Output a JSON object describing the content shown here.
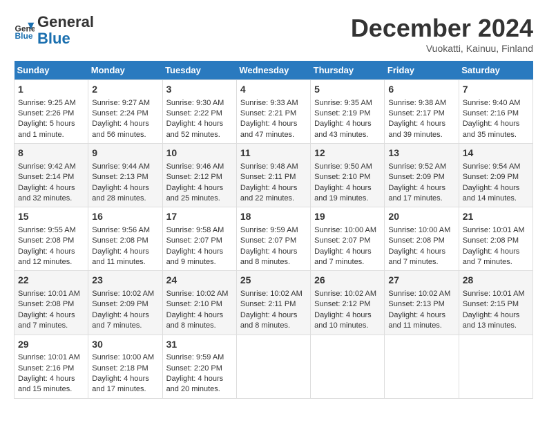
{
  "header": {
    "logo_line1": "General",
    "logo_line2": "Blue",
    "month": "December 2024",
    "location": "Vuokatti, Kainuu, Finland"
  },
  "weekdays": [
    "Sunday",
    "Monday",
    "Tuesday",
    "Wednesday",
    "Thursday",
    "Friday",
    "Saturday"
  ],
  "weeks": [
    [
      {
        "day": "1",
        "sunrise": "Sunrise: 9:25 AM",
        "sunset": "Sunset: 2:26 PM",
        "daylight": "Daylight: 5 hours and 1 minute."
      },
      {
        "day": "2",
        "sunrise": "Sunrise: 9:27 AM",
        "sunset": "Sunset: 2:24 PM",
        "daylight": "Daylight: 4 hours and 56 minutes."
      },
      {
        "day": "3",
        "sunrise": "Sunrise: 9:30 AM",
        "sunset": "Sunset: 2:22 PM",
        "daylight": "Daylight: 4 hours and 52 minutes."
      },
      {
        "day": "4",
        "sunrise": "Sunrise: 9:33 AM",
        "sunset": "Sunset: 2:21 PM",
        "daylight": "Daylight: 4 hours and 47 minutes."
      },
      {
        "day": "5",
        "sunrise": "Sunrise: 9:35 AM",
        "sunset": "Sunset: 2:19 PM",
        "daylight": "Daylight: 4 hours and 43 minutes."
      },
      {
        "day": "6",
        "sunrise": "Sunrise: 9:38 AM",
        "sunset": "Sunset: 2:17 PM",
        "daylight": "Daylight: 4 hours and 39 minutes."
      },
      {
        "day": "7",
        "sunrise": "Sunrise: 9:40 AM",
        "sunset": "Sunset: 2:16 PM",
        "daylight": "Daylight: 4 hours and 35 minutes."
      }
    ],
    [
      {
        "day": "8",
        "sunrise": "Sunrise: 9:42 AM",
        "sunset": "Sunset: 2:14 PM",
        "daylight": "Daylight: 4 hours and 32 minutes."
      },
      {
        "day": "9",
        "sunrise": "Sunrise: 9:44 AM",
        "sunset": "Sunset: 2:13 PM",
        "daylight": "Daylight: 4 hours and 28 minutes."
      },
      {
        "day": "10",
        "sunrise": "Sunrise: 9:46 AM",
        "sunset": "Sunset: 2:12 PM",
        "daylight": "Daylight: 4 hours and 25 minutes."
      },
      {
        "day": "11",
        "sunrise": "Sunrise: 9:48 AM",
        "sunset": "Sunset: 2:11 PM",
        "daylight": "Daylight: 4 hours and 22 minutes."
      },
      {
        "day": "12",
        "sunrise": "Sunrise: 9:50 AM",
        "sunset": "Sunset: 2:10 PM",
        "daylight": "Daylight: 4 hours and 19 minutes."
      },
      {
        "day": "13",
        "sunrise": "Sunrise: 9:52 AM",
        "sunset": "Sunset: 2:09 PM",
        "daylight": "Daylight: 4 hours and 17 minutes."
      },
      {
        "day": "14",
        "sunrise": "Sunrise: 9:54 AM",
        "sunset": "Sunset: 2:09 PM",
        "daylight": "Daylight: 4 hours and 14 minutes."
      }
    ],
    [
      {
        "day": "15",
        "sunrise": "Sunrise: 9:55 AM",
        "sunset": "Sunset: 2:08 PM",
        "daylight": "Daylight: 4 hours and 12 minutes."
      },
      {
        "day": "16",
        "sunrise": "Sunrise: 9:56 AM",
        "sunset": "Sunset: 2:08 PM",
        "daylight": "Daylight: 4 hours and 11 minutes."
      },
      {
        "day": "17",
        "sunrise": "Sunrise: 9:58 AM",
        "sunset": "Sunset: 2:07 PM",
        "daylight": "Daylight: 4 hours and 9 minutes."
      },
      {
        "day": "18",
        "sunrise": "Sunrise: 9:59 AM",
        "sunset": "Sunset: 2:07 PM",
        "daylight": "Daylight: 4 hours and 8 minutes."
      },
      {
        "day": "19",
        "sunrise": "Sunrise: 10:00 AM",
        "sunset": "Sunset: 2:07 PM",
        "daylight": "Daylight: 4 hours and 7 minutes."
      },
      {
        "day": "20",
        "sunrise": "Sunrise: 10:00 AM",
        "sunset": "Sunset: 2:08 PM",
        "daylight": "Daylight: 4 hours and 7 minutes."
      },
      {
        "day": "21",
        "sunrise": "Sunrise: 10:01 AM",
        "sunset": "Sunset: 2:08 PM",
        "daylight": "Daylight: 4 hours and 7 minutes."
      }
    ],
    [
      {
        "day": "22",
        "sunrise": "Sunrise: 10:01 AM",
        "sunset": "Sunset: 2:08 PM",
        "daylight": "Daylight: 4 hours and 7 minutes."
      },
      {
        "day": "23",
        "sunrise": "Sunrise: 10:02 AM",
        "sunset": "Sunset: 2:09 PM",
        "daylight": "Daylight: 4 hours and 7 minutes."
      },
      {
        "day": "24",
        "sunrise": "Sunrise: 10:02 AM",
        "sunset": "Sunset: 2:10 PM",
        "daylight": "Daylight: 4 hours and 8 minutes."
      },
      {
        "day": "25",
        "sunrise": "Sunrise: 10:02 AM",
        "sunset": "Sunset: 2:11 PM",
        "daylight": "Daylight: 4 hours and 8 minutes."
      },
      {
        "day": "26",
        "sunrise": "Sunrise: 10:02 AM",
        "sunset": "Sunset: 2:12 PM",
        "daylight": "Daylight: 4 hours and 10 minutes."
      },
      {
        "day": "27",
        "sunrise": "Sunrise: 10:02 AM",
        "sunset": "Sunset: 2:13 PM",
        "daylight": "Daylight: 4 hours and 11 minutes."
      },
      {
        "day": "28",
        "sunrise": "Sunrise: 10:01 AM",
        "sunset": "Sunset: 2:15 PM",
        "daylight": "Daylight: 4 hours and 13 minutes."
      }
    ],
    [
      {
        "day": "29",
        "sunrise": "Sunrise: 10:01 AM",
        "sunset": "Sunset: 2:16 PM",
        "daylight": "Daylight: 4 hours and 15 minutes."
      },
      {
        "day": "30",
        "sunrise": "Sunrise: 10:00 AM",
        "sunset": "Sunset: 2:18 PM",
        "daylight": "Daylight: 4 hours and 17 minutes."
      },
      {
        "day": "31",
        "sunrise": "Sunrise: 9:59 AM",
        "sunset": "Sunset: 2:20 PM",
        "daylight": "Daylight: 4 hours and 20 minutes."
      },
      null,
      null,
      null,
      null
    ]
  ]
}
